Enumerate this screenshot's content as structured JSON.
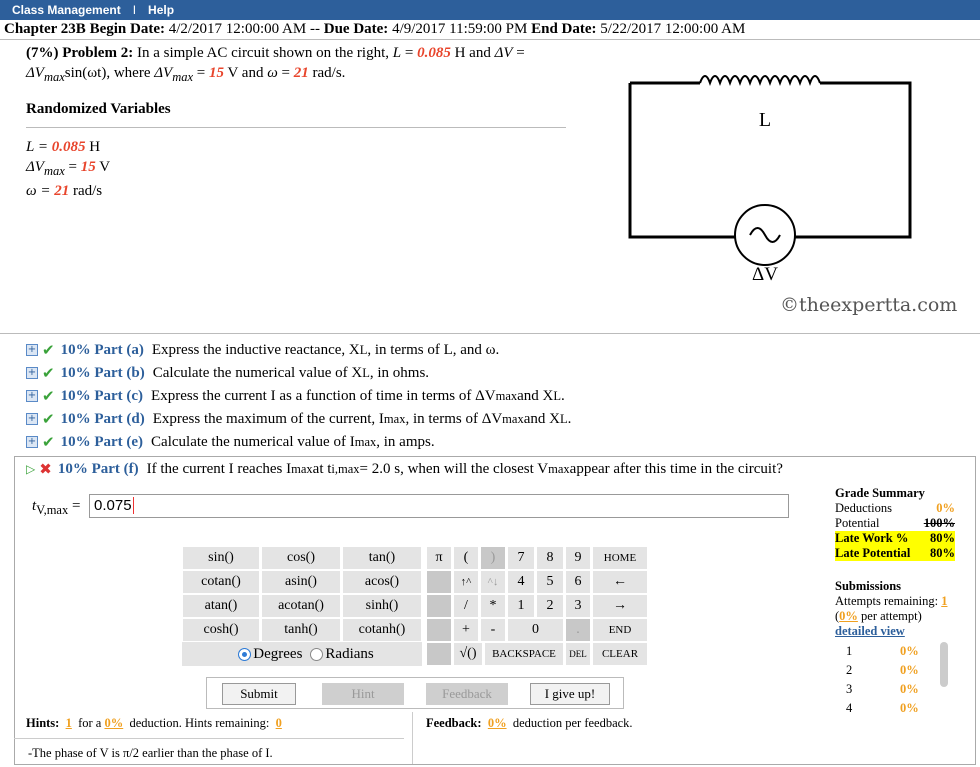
{
  "topbar": {
    "item1": "Class Management",
    "sep": "I",
    "item2": "Help"
  },
  "chapter": {
    "name": "Chapter 23B",
    "begin_label": "Begin Date:",
    "begin": "4/2/2017 12:00:00 AM --",
    "due_label": "Due Date:",
    "due": "4/9/2017 11:59:00 PM",
    "end_label": "End Date:",
    "end": "5/22/2017 12:00:00 AM"
  },
  "problem": {
    "head": "(7%) Problem 2:",
    "t1": " In a simple AC circuit shown on the right, ",
    "L_sym": "L",
    "eq": " = ",
    "L_val": "0.085",
    "t2": " H and ",
    "dV": "ΔV",
    "t3": " = ",
    "dVmax": "ΔV",
    "max": "max",
    "sin": "sin(ωt), where ",
    "dVmax2": "ΔV",
    "max2": "max",
    "eq2": " = ",
    "V_val": "15",
    "t4": " V and ",
    "w": "ω",
    "eq3": " = ",
    "w_val": "21",
    "t5": " rad/s."
  },
  "rv": {
    "title": "Randomized Variables",
    "l1a": "L = ",
    "l1v": "0.085",
    "l1u": " H",
    "l2a": "ΔV",
    "l2s": "max",
    "l2b": " = ",
    "l2v": "15",
    "l2u": " V",
    "l3a": "ω = ",
    "l3v": "21",
    "l3u": " rad/s"
  },
  "circuit": {
    "inductor_label": "L",
    "source_label": "ΔV"
  },
  "copyright": "©theexpertta.com",
  "parts": [
    {
      "label": "10% Part (a)",
      "text": "Express the inductive reactance, X",
      "sub": "L",
      "text2": ", in terms of L, and ω."
    },
    {
      "label": "10% Part (b)",
      "text": "Calculate the numerical value of X",
      "sub": "L",
      "text2": ", in ohms."
    },
    {
      "label": "10% Part (c)",
      "text": "Express the current I as a function of time in terms of ΔV",
      "sub": "max",
      "text2": " and X",
      "sub2": "L",
      "text3": "."
    },
    {
      "label": "10% Part (d)",
      "text": "Express the maximum of the current, I",
      "sub": "max",
      "text2": ", in terms of ΔV",
      "sub2": "max",
      "text3": " and X",
      "sub3": "L",
      "text4": "."
    },
    {
      "label": "10% Part (e)",
      "text": "Calculate the numerical value of I",
      "sub": "max",
      "text2": ", in amps."
    },
    {
      "label": "10% Part (f)",
      "text": "If the current I reaches I",
      "sub": "max",
      "text2": " at t",
      "sub2": "i,max",
      "text3": " = 2.0 s, when will the closest V",
      "sub3": "max",
      "text4": " appear after this time in the circuit?"
    }
  ],
  "answer": {
    "label_t": "t",
    "label_sub": "V,max",
    "label_eq": " = ",
    "value": "0.075"
  },
  "keypad": {
    "funcs": [
      "sin()",
      "cos()",
      "tan()",
      "cotan()",
      "asin()",
      "acos()",
      "atan()",
      "acotan()",
      "sinh()",
      "cosh()",
      "tanh()",
      "cotanh()"
    ],
    "pi": "π",
    "lparen": "(",
    "rparen": ")",
    "up": "↑^",
    "down": "^↓",
    "slash": "/",
    "star": "*",
    "plus": "+",
    "minus": "-",
    "sqrt": "√()",
    "digits": [
      "7",
      "8",
      "9",
      "4",
      "5",
      "6",
      "1",
      "2",
      "3",
      "0",
      "."
    ],
    "home": "HOME",
    "left": "←",
    "right": "→",
    "end": "END",
    "backspace": "BACKSPACE",
    "del": "DEL",
    "clear": "CLEAR",
    "degrees": "Degrees",
    "radians": "Radians"
  },
  "buttons": {
    "submit": "Submit",
    "hint": "Hint",
    "feedback": "Feedback",
    "giveup": "I give up!"
  },
  "hints": {
    "label": "Hints:",
    "n": "1",
    "t1": "for a",
    "pct": "0%",
    "t2": "deduction. Hints remaining:",
    "rem": "0",
    "text": "-The phase of V is π/2 earlier than the phase of I."
  },
  "feedback": {
    "label": "Feedback:",
    "pct": "0%",
    "text": "deduction per feedback."
  },
  "grade": {
    "title": "Grade Summary",
    "rows": [
      {
        "k": "Deductions",
        "v": "0%"
      },
      {
        "k": "Potential",
        "v": "100%"
      },
      {
        "k": "Late Work %",
        "v": "80%"
      },
      {
        "k": "Late Potential",
        "v": "80%"
      }
    ]
  },
  "submissions": {
    "title": "Submissions",
    "attempts": "Attempts remaining:",
    "attempts_n": "1",
    "per_open": "(",
    "per_pct": "0%",
    "per_close": " per attempt)",
    "detail": "detailed view",
    "list": [
      {
        "i": "1",
        "v": "0%"
      },
      {
        "i": "2",
        "v": "0%"
      },
      {
        "i": "3",
        "v": "0%"
      },
      {
        "i": "4",
        "v": "0%"
      }
    ]
  }
}
